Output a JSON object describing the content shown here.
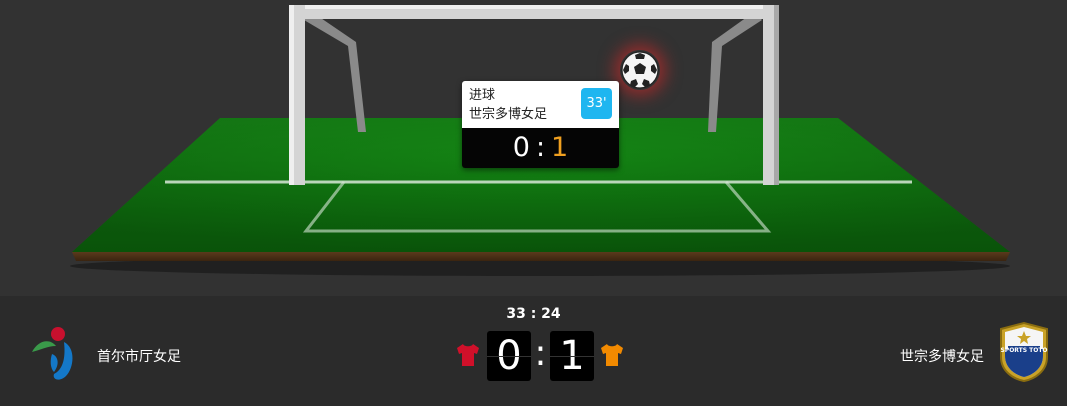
{
  "event": {
    "type": "进球",
    "team": "世宗多博女足",
    "minute": "33'",
    "score_home": "0",
    "score_sep": ":",
    "score_away": "1"
  },
  "match": {
    "clock": "33 : 24",
    "home_team": "首尔市厅女足",
    "away_team": "世宗多博女足",
    "home_score": "0",
    "away_score": "1",
    "score_sep": ":",
    "home_kit_color": "#d0102a",
    "away_kit_color": "#f28a00"
  },
  "away_logo": {
    "text": "SPORTS TOTO"
  },
  "colors": {
    "pitch_green": "#1e8a1e",
    "minute_badge": "#1fb6f0",
    "away_score_highlight": "#f0a020",
    "event_highlight": "#e02828"
  },
  "icons": [
    "soccer-ball-icon",
    "home-kit-shirt-icon",
    "away-kit-shirt-icon"
  ]
}
